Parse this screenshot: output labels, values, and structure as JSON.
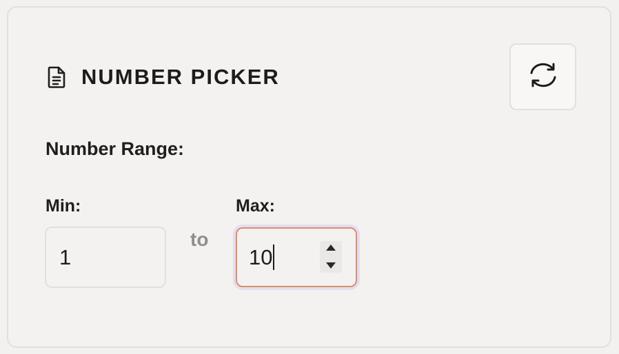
{
  "header": {
    "title": "NUMBER PICKER",
    "icon": "document-icon",
    "refresh_icon": "refresh-icon"
  },
  "range": {
    "section_label": "Number Range:",
    "min_label": "Min:",
    "min_value": "1",
    "separator": "to",
    "max_label": "Max:",
    "max_value": "10"
  },
  "colors": {
    "focus_border": "#d9906a",
    "focus_ring": "#e6dcf0",
    "muted_text": "#8f8e89"
  }
}
